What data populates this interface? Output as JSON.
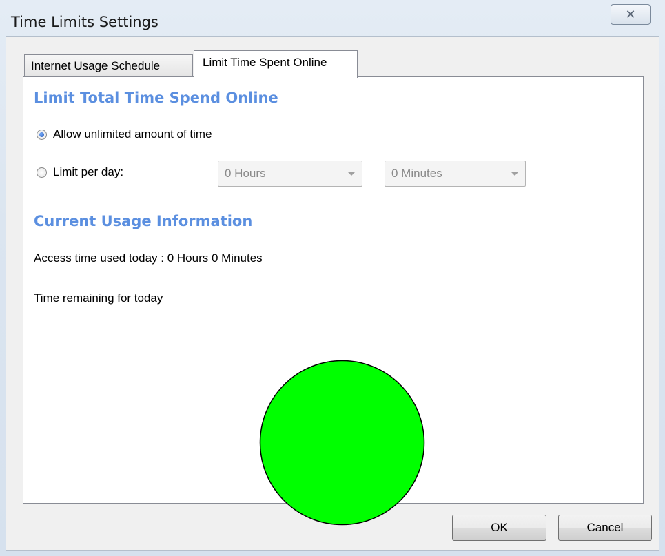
{
  "window": {
    "title": "Time Limits Settings",
    "close_glyph": "✕"
  },
  "tabs": [
    {
      "label": "Internet Usage Schedule",
      "active": false
    },
    {
      "label": "Limit Time Spent Online",
      "active": true
    }
  ],
  "limit_section": {
    "heading": "Limit Total Time Spend Online",
    "option_unlimited": {
      "label": "Allow unlimited amount of time",
      "checked": true
    },
    "option_limit": {
      "label": "Limit per day:",
      "checked": false
    },
    "hours_select": {
      "value": "0 Hours",
      "enabled": false
    },
    "minutes_select": {
      "value": "0 Minutes",
      "enabled": false
    }
  },
  "usage_section": {
    "heading": "Current Usage Information",
    "access_used": "Access time used today : 0 Hours 0 Minutes",
    "remaining_label": "Time remaining for today",
    "remaining_color": "#00ff00",
    "remaining_fraction": 1.0
  },
  "buttons": {
    "ok": "OK",
    "cancel": "Cancel"
  }
}
